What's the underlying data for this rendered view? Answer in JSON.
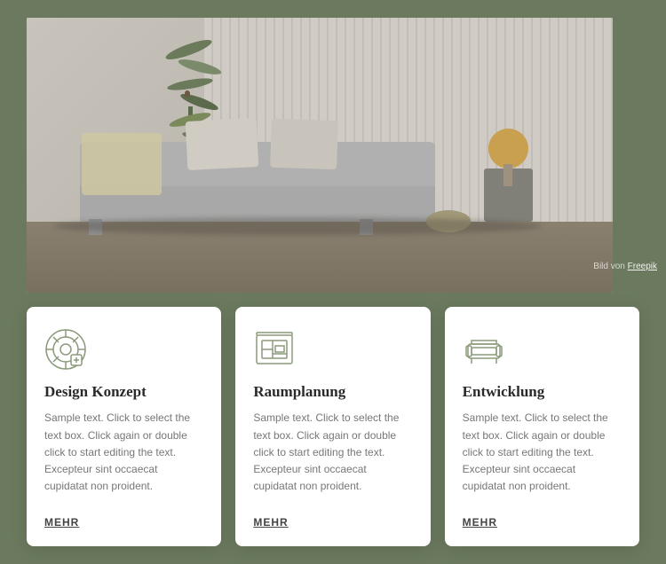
{
  "background": {
    "color_main": "#6b7a5e",
    "color_accent": "#8a9a7a"
  },
  "hero": {
    "credit_prefix": "Bild von",
    "credit_link_text": "Freepik"
  },
  "cards": [
    {
      "id": "design-konzept",
      "icon_name": "design-icon",
      "title": "Design Konzept",
      "body": "Sample text. Click to select the text box. Click again or double click to start editing the text. Excepteur sint occaecat cupidatat non proident.",
      "link_label": "MEHR"
    },
    {
      "id": "raumplanung",
      "icon_name": "floor-plan-icon",
      "title": "Raumplanung",
      "body": "Sample text. Click to select the text box. Click again or double click to start editing the text. Excepteur sint occaecat cupidatat non proident.",
      "link_label": "MEHR"
    },
    {
      "id": "entwicklung",
      "icon_name": "sofa-icon",
      "title": "Entwicklung",
      "body": "Sample text. Click to select the text box. Click again or double click to start editing the text. Excepteur sint occaecat cupidatat non proident.",
      "link_label": "MEHR"
    }
  ]
}
